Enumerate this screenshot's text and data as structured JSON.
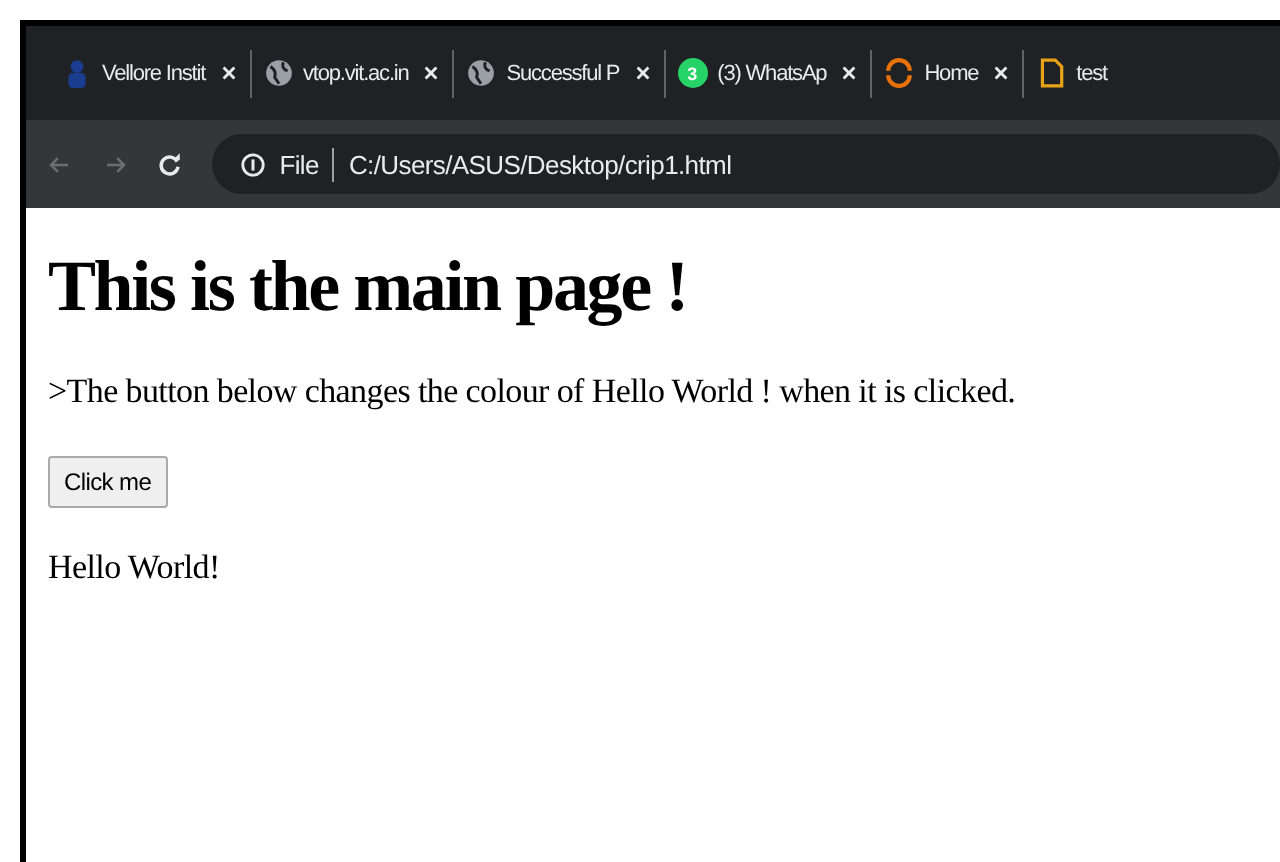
{
  "browser": {
    "tabs": [
      {
        "kind": "figure",
        "title": "Vellore Instit",
        "selected": false
      },
      {
        "kind": "globe",
        "title": "vtop.vit.ac.in",
        "selected": false
      },
      {
        "kind": "globe",
        "title": "Successful P",
        "selected": false
      },
      {
        "kind": "chat",
        "badge": "3",
        "title": "(3) WhatsAp",
        "selected": false
      },
      {
        "kind": "ring",
        "title": "Home",
        "selected": false
      },
      {
        "kind": "document",
        "title": "test",
        "selected": false
      }
    ],
    "address_bar": {
      "scheme": "File",
      "url": "C:/Users/ASUS/Desktop/crip1.html"
    }
  },
  "page": {
    "heading": "This is the main page !",
    "paragraph": ">The button below changes the colour of Hello World ! when it is clicked.",
    "button": "Click me",
    "output": "Hello World!"
  }
}
